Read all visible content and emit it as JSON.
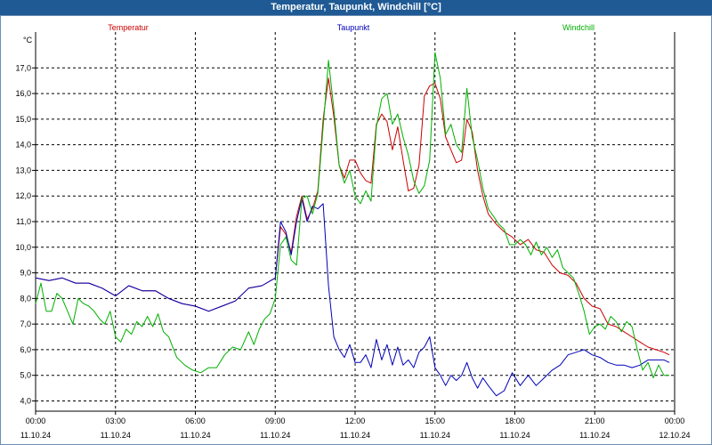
{
  "window": {
    "title": "Temperatur, Taupunkt, Windchill [°C]"
  },
  "chart_data": {
    "type": "line",
    "title": "Temperatur, Taupunkt, Windchill [°C]",
    "ylabel": "°C",
    "ylim": [
      3.6,
      18.4
    ],
    "yticks": [
      "4,0",
      "5,0",
      "6,0",
      "7,0",
      "8,0",
      "9,0",
      "10,0",
      "11,0",
      "12,0",
      "13,0",
      "14,0",
      "15,0",
      "16,0",
      "17,0"
    ],
    "xlim": [
      0,
      24
    ],
    "xticks": [
      {
        "time": "00:00",
        "date": "11.10.24"
      },
      {
        "time": "03:00",
        "date": "11.10.24"
      },
      {
        "time": "06:00",
        "date": "11.10.24"
      },
      {
        "time": "09:00",
        "date": "11.10.24"
      },
      {
        "time": "12:00",
        "date": "11.10.24"
      },
      {
        "time": "15:00",
        "date": "11.10.24"
      },
      {
        "time": "18:00",
        "date": "11.10.24"
      },
      {
        "time": "21:00",
        "date": "11.10.24"
      },
      {
        "time": "00:00",
        "date": "12.10.24"
      }
    ],
    "grid": true,
    "series": [
      {
        "name": "Temperatur",
        "color": "#cc0000",
        "x": [
          0,
          0.5,
          1,
          1.5,
          2,
          2.5,
          3,
          3.5,
          4,
          4.5,
          5,
          5.5,
          6,
          6.5,
          7,
          7.5,
          8,
          8.5,
          9,
          9.2,
          9.4,
          9.6,
          9.8,
          10,
          10.2,
          10.4,
          10.6,
          10.8,
          11,
          11.2,
          11.4,
          11.6,
          11.8,
          12,
          12.2,
          12.4,
          12.6,
          12.8,
          13,
          13.2,
          13.4,
          13.6,
          13.8,
          14,
          14.2,
          14.4,
          14.6,
          14.8,
          15,
          15.2,
          15.4,
          15.6,
          15.8,
          16,
          16.2,
          16.4,
          16.6,
          16.8,
          17,
          17.3,
          17.6,
          17.9,
          18.2,
          18.5,
          18.8,
          19.1,
          19.4,
          19.7,
          20,
          20.3,
          20.6,
          20.9,
          21.2,
          21.5,
          21.8,
          22.1,
          22.4,
          22.7,
          23,
          23.3,
          23.6,
          23.8
        ],
        "values": [
          8.8,
          8.7,
          8.8,
          8.6,
          8.6,
          8.4,
          8.1,
          8.5,
          8.3,
          8.3,
          8.0,
          7.8,
          7.7,
          7.5,
          7.7,
          7.9,
          8.4,
          8.5,
          8.8,
          10.8,
          10.5,
          9.8,
          11.2,
          12.0,
          11.1,
          11.5,
          12.2,
          15.0,
          16.6,
          15.1,
          13.2,
          12.7,
          13.4,
          13.4,
          12.9,
          12.6,
          12.5,
          14.8,
          15.2,
          14.9,
          13.8,
          14.7,
          13.4,
          12.2,
          12.3,
          13.2,
          15.9,
          16.3,
          16.4,
          15.8,
          14.3,
          13.8,
          13.3,
          13.4,
          15.0,
          14.5,
          13.0,
          12.0,
          11.3,
          10.9,
          10.6,
          10.4,
          10.1,
          10.3,
          9.9,
          9.8,
          9.3,
          9.0,
          8.9,
          8.6,
          8.0,
          7.7,
          7.6,
          7.0,
          6.9,
          6.7,
          6.5,
          6.3,
          6.1,
          6.0,
          5.9,
          5.8
        ]
      },
      {
        "name": "Taupunkt",
        "color": "#0000b8",
        "x": [
          0,
          0.5,
          1,
          1.5,
          2,
          2.5,
          3,
          3.5,
          4,
          4.5,
          5,
          5.5,
          6,
          6.5,
          7,
          7.5,
          8,
          8.5,
          9,
          9.2,
          9.4,
          9.6,
          9.8,
          10,
          10.2,
          10.4,
          10.6,
          10.8,
          11,
          11.2,
          11.4,
          11.6,
          11.8,
          12,
          12.2,
          12.4,
          12.6,
          12.8,
          13,
          13.2,
          13.4,
          13.6,
          13.8,
          14,
          14.2,
          14.4,
          14.6,
          14.8,
          15,
          15.2,
          15.4,
          15.6,
          15.8,
          16,
          16.2,
          16.4,
          16.6,
          16.8,
          17,
          17.3,
          17.6,
          17.9,
          18.2,
          18.5,
          18.8,
          19.1,
          19.4,
          19.7,
          20,
          20.3,
          20.6,
          20.9,
          21.2,
          21.5,
          21.8,
          22.1,
          22.4,
          22.7,
          23,
          23.3,
          23.6,
          23.8
        ],
        "values": [
          8.8,
          8.7,
          8.8,
          8.6,
          8.6,
          8.4,
          8.1,
          8.5,
          8.3,
          8.3,
          8.0,
          7.8,
          7.7,
          7.5,
          7.7,
          7.9,
          8.4,
          8.5,
          8.8,
          11.0,
          10.6,
          9.7,
          11.0,
          11.9,
          11.0,
          11.6,
          11.5,
          11.7,
          8.5,
          6.5,
          6.0,
          5.7,
          6.2,
          5.5,
          5.5,
          5.8,
          5.3,
          6.4,
          5.6,
          6.2,
          5.4,
          6.1,
          5.4,
          5.6,
          5.3,
          5.9,
          6.1,
          6.5,
          5.3,
          5.0,
          4.6,
          5.0,
          4.8,
          5.0,
          5.5,
          4.9,
          4.5,
          4.9,
          4.6,
          4.2,
          4.4,
          5.1,
          4.6,
          5.0,
          4.6,
          4.9,
          5.2,
          5.4,
          5.8,
          5.9,
          6.0,
          5.8,
          5.7,
          5.5,
          5.4,
          5.4,
          5.3,
          5.4,
          5.6,
          5.6,
          5.6,
          5.5
        ]
      },
      {
        "name": "Windchill",
        "color": "#00b000",
        "x": [
          0,
          0.2,
          0.4,
          0.6,
          0.8,
          1,
          1.2,
          1.4,
          1.6,
          1.8,
          2,
          2.2,
          2.4,
          2.6,
          2.8,
          3,
          3.2,
          3.4,
          3.6,
          3.8,
          4,
          4.2,
          4.4,
          4.6,
          4.8,
          5,
          5.3,
          5.6,
          5.9,
          6.2,
          6.5,
          6.8,
          7.1,
          7.4,
          7.7,
          8,
          8.2,
          8.4,
          8.6,
          8.8,
          9,
          9.2,
          9.4,
          9.6,
          9.8,
          10,
          10.2,
          10.4,
          10.6,
          10.8,
          11,
          11.2,
          11.4,
          11.6,
          11.8,
          12,
          12.2,
          12.4,
          12.6,
          12.8,
          13,
          13.2,
          13.4,
          13.6,
          13.8,
          14,
          14.2,
          14.4,
          14.6,
          14.8,
          15,
          15.2,
          15.4,
          15.6,
          15.8,
          16,
          16.2,
          16.4,
          16.6,
          16.8,
          17,
          17.2,
          17.4,
          17.6,
          17.8,
          18,
          18.2,
          18.4,
          18.6,
          18.8,
          19,
          19.2,
          19.4,
          19.6,
          19.8,
          20,
          20.2,
          20.4,
          20.6,
          20.8,
          21,
          21.2,
          21.4,
          21.6,
          21.8,
          22,
          22.2,
          22.4,
          22.6,
          22.8,
          23,
          23.2,
          23.4,
          23.6,
          23.8
        ],
        "values": [
          7.8,
          8.6,
          7.5,
          7.5,
          8.2,
          8.0,
          7.5,
          7.0,
          8.0,
          7.8,
          7.7,
          7.5,
          7.2,
          7.0,
          7.5,
          6.5,
          6.3,
          6.8,
          6.6,
          7.1,
          6.9,
          7.3,
          6.9,
          7.4,
          6.7,
          6.5,
          5.7,
          5.4,
          5.2,
          5.1,
          5.3,
          5.3,
          5.8,
          6.1,
          6.0,
          6.7,
          6.2,
          6.8,
          7.2,
          7.4,
          8.0,
          10.1,
          10.4,
          9.5,
          9.3,
          11.9,
          12.0,
          11.3,
          12.1,
          14.7,
          17.3,
          15.4,
          13.2,
          12.5,
          13.0,
          12.0,
          11.7,
          12.2,
          11.8,
          14.7,
          15.8,
          16.0,
          14.8,
          15.2,
          14.3,
          13.6,
          12.6,
          12.1,
          12.4,
          13.4,
          17.6,
          16.6,
          14.4,
          14.8,
          14.0,
          13.7,
          16.2,
          14.3,
          13.4,
          12.3,
          11.5,
          11.2,
          10.9,
          10.7,
          10.1,
          10.1,
          10.3,
          10.1,
          9.7,
          10.2,
          9.7,
          10.0,
          9.6,
          9.9,
          9.2,
          9.0,
          8.8,
          8.2,
          7.5,
          6.6,
          6.9,
          7.0,
          6.8,
          7.3,
          7.1,
          6.7,
          7.1,
          6.9,
          6.0,
          5.2,
          5.5,
          4.9,
          5.4,
          5.0,
          5.0
        ]
      }
    ]
  }
}
